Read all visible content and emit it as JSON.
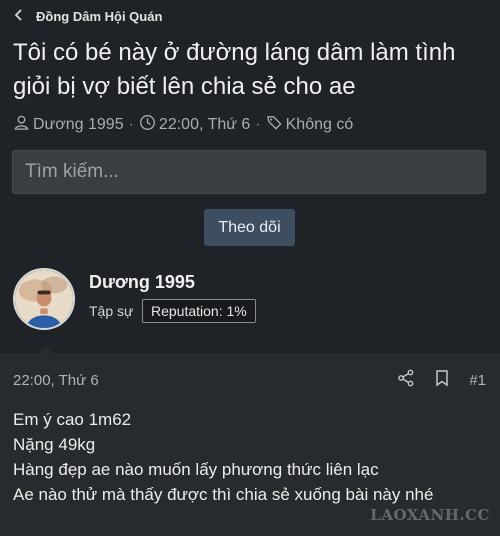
{
  "breadcrumb": {
    "label": "Đồng Dâm Hội Quán"
  },
  "thread": {
    "title": "Tôi có bé này ở đường láng dâm làm tình giỏi bị vợ biết lên chia sẻ cho ae",
    "meta": {
      "author": "Dương 1995",
      "time": "22:00, Thứ 6",
      "tags": "Không có"
    }
  },
  "search": {
    "placeholder": "Tìm kiếm..."
  },
  "follow": {
    "label": "Theo dõi"
  },
  "author_card": {
    "name": "Dương 1995",
    "role": "Tập sự",
    "reputation": "Reputation: 1%"
  },
  "post": {
    "date": "22:00, Thứ 6",
    "number": "#1",
    "lines": [
      "Em ý cao 1m62",
      "Nặng 49kg",
      "Hàng đẹp ae nào muốn lấy phương thức liên lạc",
      "Ae nào thử mà thấy được thì chia sẻ xuống bài này nhé"
    ]
  },
  "watermark": "LAOXANH.CC",
  "icons": {
    "back": "chevron-left-icon",
    "user": "user-icon",
    "clock": "clock-icon",
    "tag": "tag-icon",
    "share": "share-icon",
    "bookmark": "bookmark-icon"
  },
  "colors": {
    "background": "#1f2226",
    "button": "#3c4e60",
    "post_bg": "#272a2e"
  }
}
